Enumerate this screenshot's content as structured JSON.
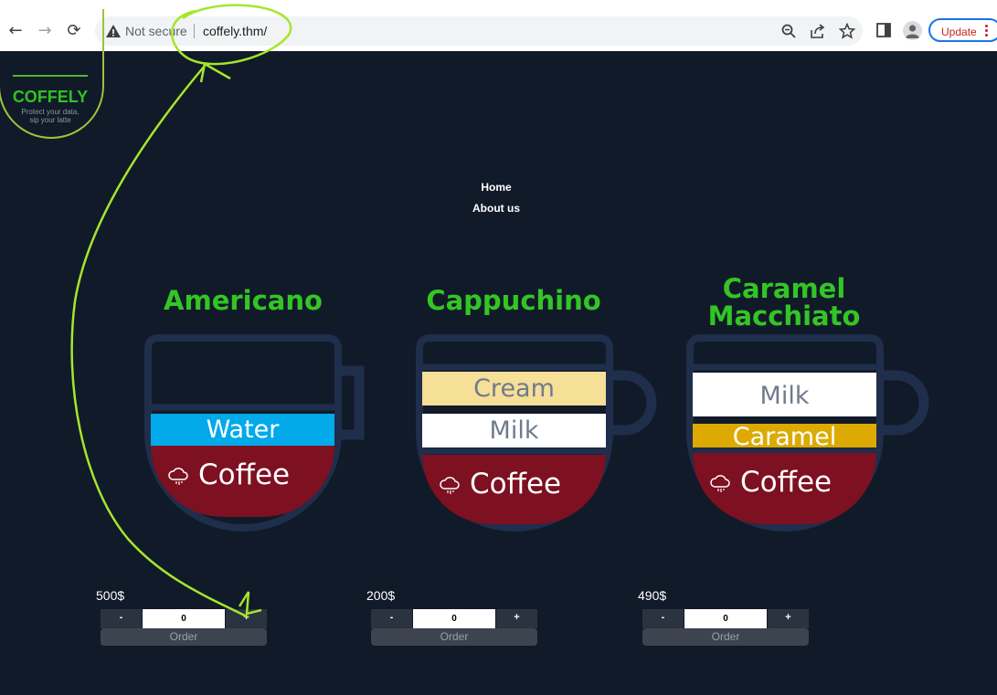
{
  "browser": {
    "security_label": "Not secure",
    "url": "coffely.thm/",
    "update_label": "Update"
  },
  "logo": {
    "name": "COFFELY",
    "tagline_1": "Protect your data,",
    "tagline_2": "sip your latte"
  },
  "nav": {
    "home": "Home",
    "about": "About us"
  },
  "products": [
    {
      "title": "Americano",
      "layers": [
        "Water"
      ],
      "base": "Coffee",
      "price": "500$",
      "quantity": "0"
    },
    {
      "title": "Cappuchino",
      "layers": [
        "Cream",
        "Milk"
      ],
      "base": "Coffee",
      "price": "200$",
      "quantity": "0"
    },
    {
      "title_line1": "Caramel",
      "title_line2": "Macchiato",
      "layers": [
        "Milk",
        "Caramel"
      ],
      "base": "Coffee",
      "price": "490$",
      "quantity": "0"
    }
  ],
  "controls": {
    "minus": "-",
    "plus": "+",
    "order": "Order"
  },
  "colors": {
    "page_bg": "#111a29",
    "accent_green": "#32c625",
    "cup_outline": "#1f2e4a",
    "coffee": "#7d1021",
    "water": "#02aaea",
    "cream": "#f6df97",
    "milk": "#ffffff",
    "caramel": "#dcaa02",
    "annotation": "#a5e62c"
  },
  "icons": [
    "back-arrow-icon",
    "forward-arrow-icon",
    "reload-icon",
    "warning-icon",
    "zoom-icon",
    "share-icon",
    "bookmark-star-icon",
    "side-panel-icon",
    "profile-icon",
    "menu-kebab-icon",
    "cloud-icon"
  ]
}
